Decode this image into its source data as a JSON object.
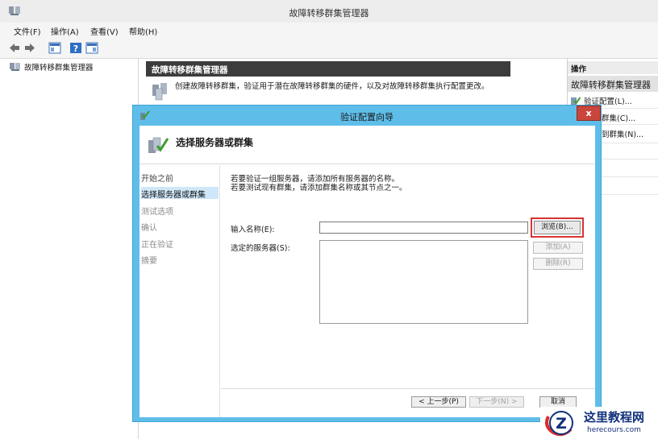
{
  "window": {
    "title": "故障转移群集管理器"
  },
  "menu": [
    "文件(F)",
    "操作(A)",
    "查看(V)",
    "帮助(H)"
  ],
  "tree": {
    "root_label": "故障转移群集管理器"
  },
  "center": {
    "header": "故障转移群集管理器",
    "description": "创建故障转移群集，验证用于潜在故障转移群集的硬件，以及对故障转移群集执行配置更改。"
  },
  "actions": {
    "header": "操作",
    "section": "故障转移群集管理器",
    "items": [
      "验证配置(L)...",
      "群集(C)...",
      "到群集(N)..."
    ]
  },
  "dialog": {
    "title": "验证配置向导",
    "heading": "选择服务器或群集",
    "close_label": "x",
    "steps": [
      "开始之前",
      "选择服务器或群集",
      "测试选项",
      "确认",
      "正在验证",
      "摘要"
    ],
    "instruction_line1": "若要验证一组服务器，请添加所有服务器的名称。",
    "instruction_line2": "若要测试现有群集，请添加群集名称或其节点之一。",
    "name_label": "输入名称(E):",
    "name_value": "",
    "browse_label": "浏览(B)...",
    "selected_label": "选定的服务器(S):",
    "add_label": "添加(A)",
    "remove_label": "删除(R)",
    "prev_label": "< 上一步(P)",
    "next_label": "下一步(N) >",
    "cancel_label": "取消"
  },
  "watermark": {
    "cn": "这里教程网",
    "en": "herecours.com"
  }
}
